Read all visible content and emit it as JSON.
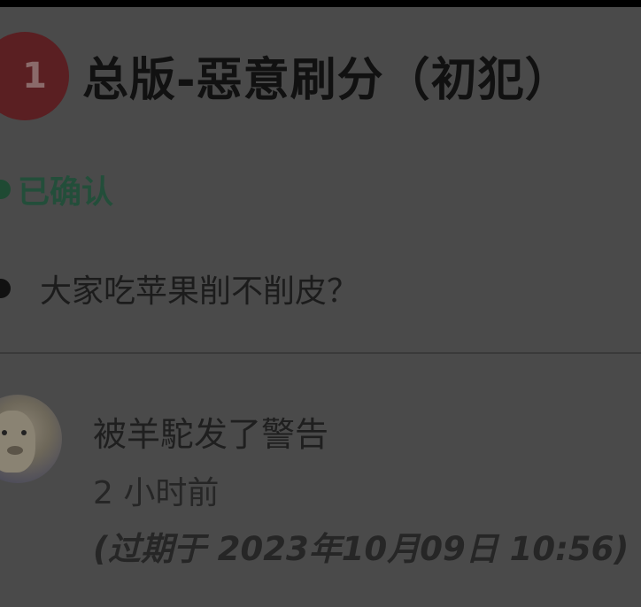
{
  "header": {
    "level": "1",
    "title": "总版-惡意刷分（初犯）"
  },
  "status": {
    "label": "已确认"
  },
  "post": {
    "title": "大家吃苹果削不削皮？"
  },
  "activity": {
    "action": "被羊駝发了警告",
    "time_ago": "2 小时前",
    "expiry": "(过期于 2023年10月09日 10:56)"
  },
  "colors": {
    "badge": "#5a1f22",
    "status_green": "#234e3a",
    "background": "#4a4a4a"
  }
}
